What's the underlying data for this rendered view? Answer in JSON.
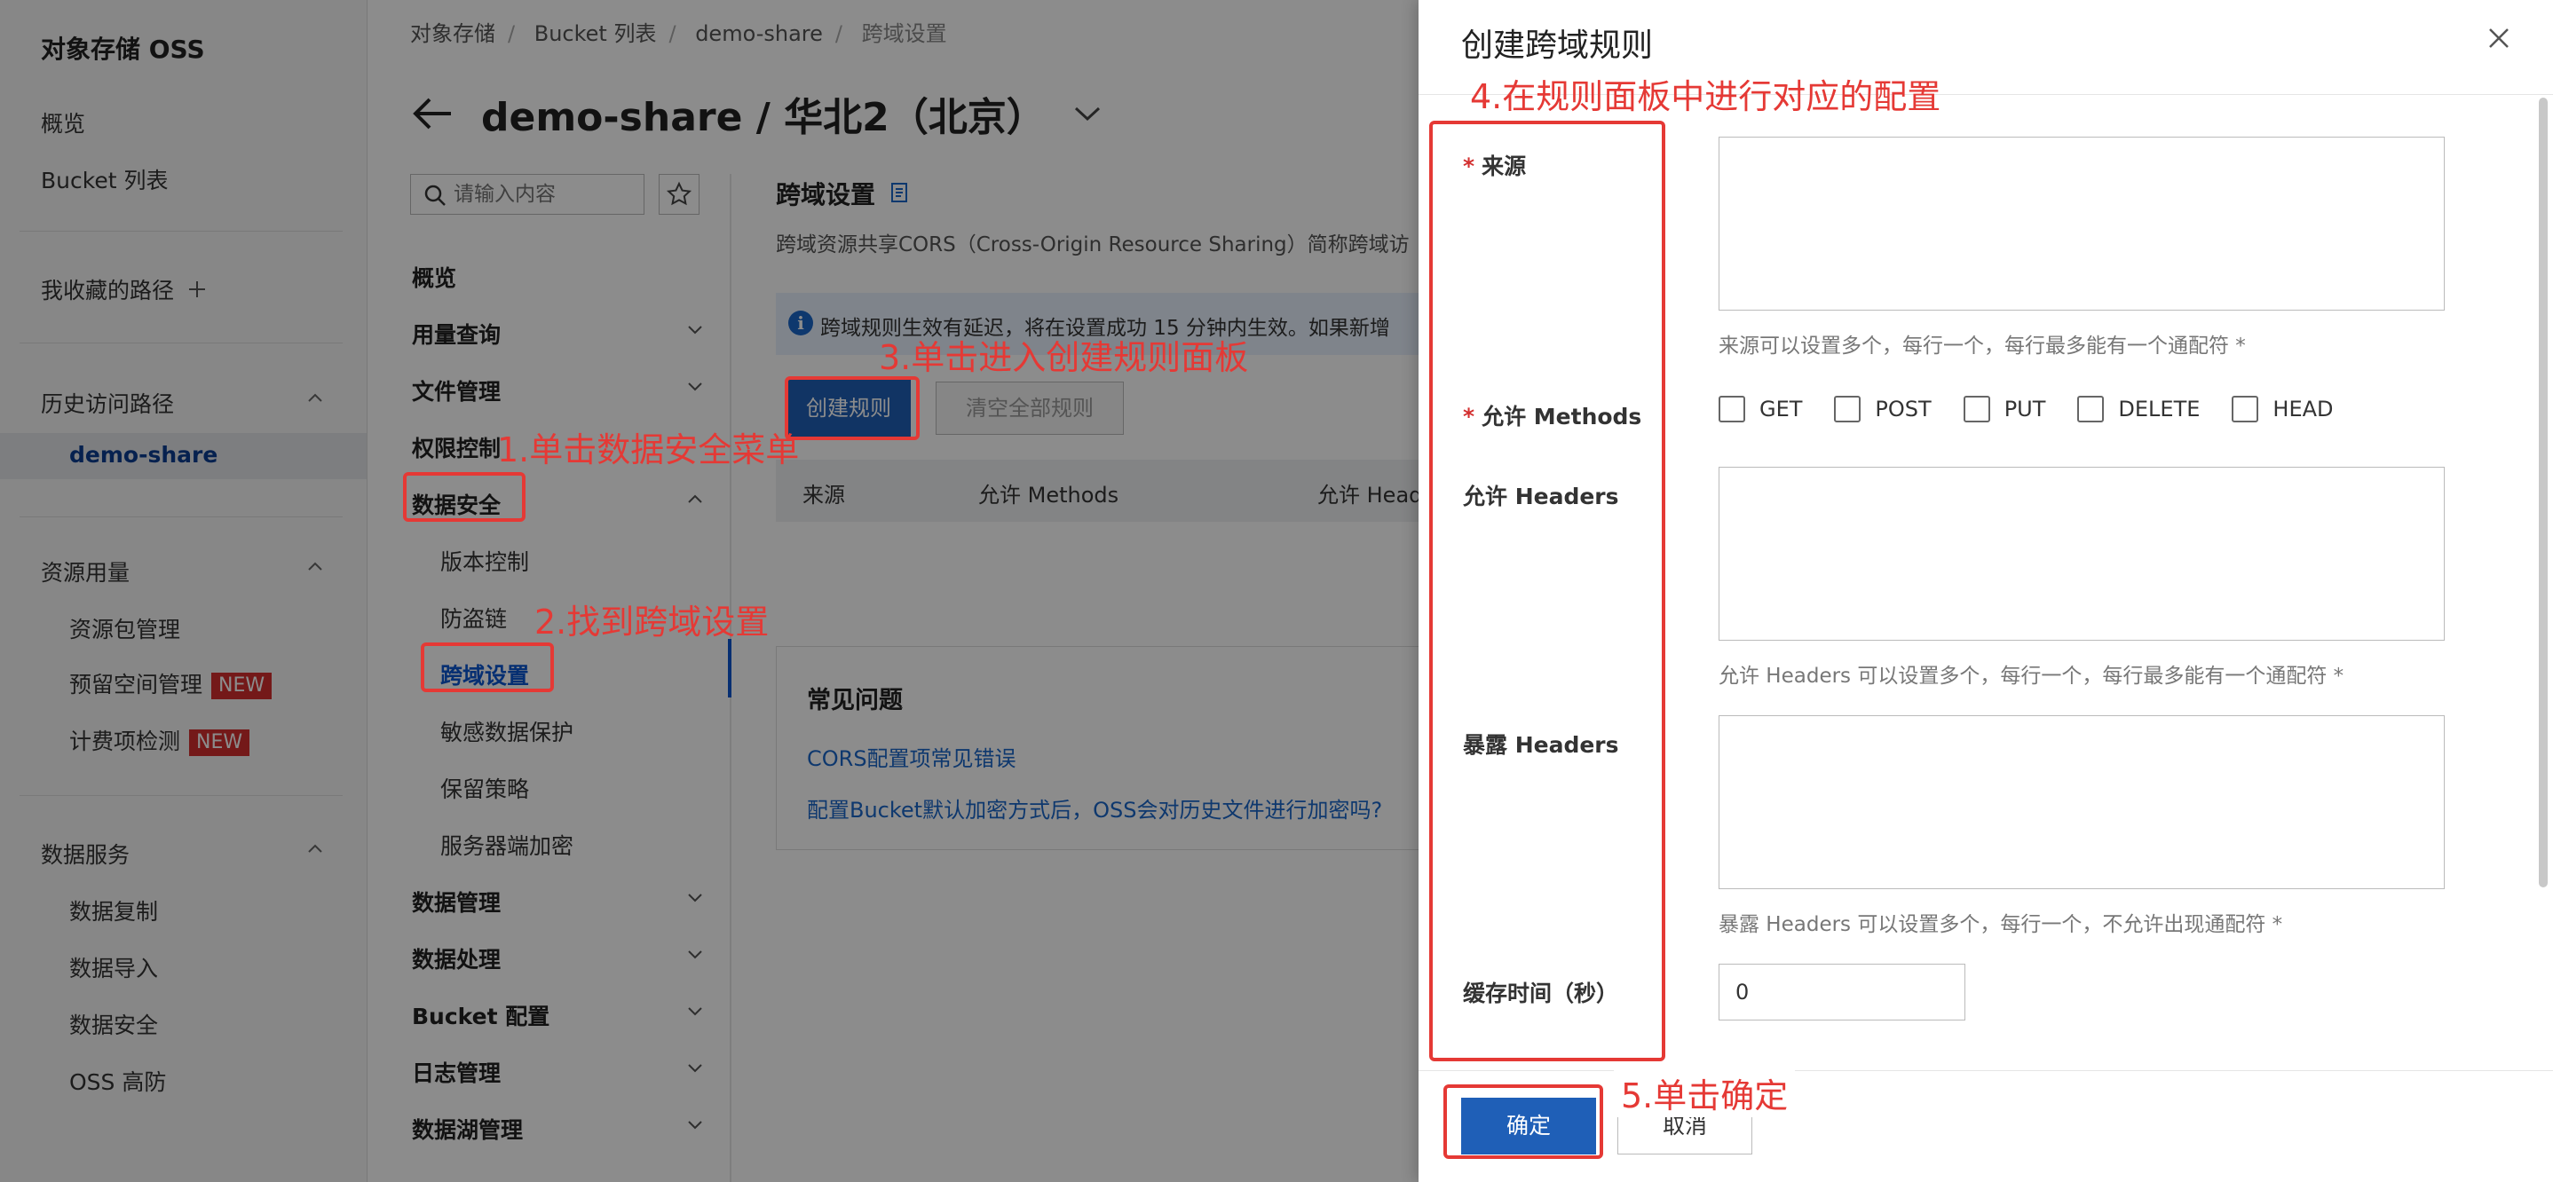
{
  "left_nav": {
    "title": "对象存储 OSS",
    "overview": "概览",
    "bucket_list": "Bucket 列表",
    "favorites": "我收藏的路径",
    "history_group": "历史访问路径",
    "history_active": "demo-share",
    "resource_group": "资源用量",
    "resource_pack": "资源包管理",
    "reserved_space": "预留空间管理",
    "billing_check": "计费项检测",
    "new_badge": "NEW",
    "data_service_group": "数据服务",
    "data_replication": "数据复制",
    "data_import": "数据导入",
    "data_security": "数据安全",
    "oss_ddos": "OSS 高防"
  },
  "breadcrumb": [
    "对象存储",
    "Bucket 列表",
    "demo-share",
    "跨域设置"
  ],
  "bucket_title": "demo-share / 华北2（北京）",
  "subnav": {
    "search_placeholder": "请输入内容",
    "overview": "概览",
    "usage": "用量查询",
    "file_mgmt": "文件管理",
    "access_control": "权限控制",
    "data_security": "数据安全",
    "versioning": "版本控制",
    "hotlink": "防盗链",
    "cors": "跨域设置",
    "sensitive": "敏感数据保护",
    "retention": "保留策略",
    "encryption": "服务器端加密",
    "data_mgmt": "数据管理",
    "data_processing": "数据处理",
    "bucket_config": "Bucket 配置",
    "log_mgmt": "日志管理",
    "data_lake": "数据湖管理"
  },
  "page": {
    "heading": "跨域设置",
    "description": "跨域资源共享CORS（Cross-Origin Resource Sharing）简称跨域访",
    "info": "跨域规则生效有延迟，将在设置成功 15 分钟内生效。如果新增",
    "create_button": "创建规则",
    "clear_button": "清空全部规则",
    "table_headers": [
      "来源",
      "允许 Methods",
      "允许 Head"
    ],
    "faq_title": "常见问题",
    "faq_links": [
      "CORS配置项常见错误",
      "配置Bucket默认加密方式后，OSS会对历史文件进行加密吗?"
    ]
  },
  "drawer": {
    "title": "创建跨域规则",
    "origin_label": "来源",
    "origin_help": "来源可以设置多个，每行一个，每行最多能有一个通配符 *",
    "methods_label": "允许 Methods",
    "methods": [
      "GET",
      "POST",
      "PUT",
      "DELETE",
      "HEAD"
    ],
    "allow_headers_label": "允许 Headers",
    "allow_headers_help": "允许 Headers 可以设置多个，每行一个，每行最多能有一个通配符 *",
    "expose_headers_label": "暴露 Headers",
    "expose_headers_help": "暴露 Headers 可以设置多个，每行一个，不允许出现通配符 *",
    "cache_label": "缓存时间（秒）",
    "cache_value": "0",
    "ok_button": "确定",
    "cancel_button": "取消"
  },
  "annotations": {
    "step1": "1.单击数据安全菜单",
    "step2": "2.找到跨域设置",
    "step3": "3.单击进入创建规则面板",
    "step4": "4.在规则面板中进行对应的配置",
    "step5": "5.单击确定"
  },
  "colors": {
    "accent_blue": "#1f5fb7",
    "link_blue": "#1b66c9",
    "annotation_red": "#e53935",
    "badge_red": "#d32f2f"
  }
}
